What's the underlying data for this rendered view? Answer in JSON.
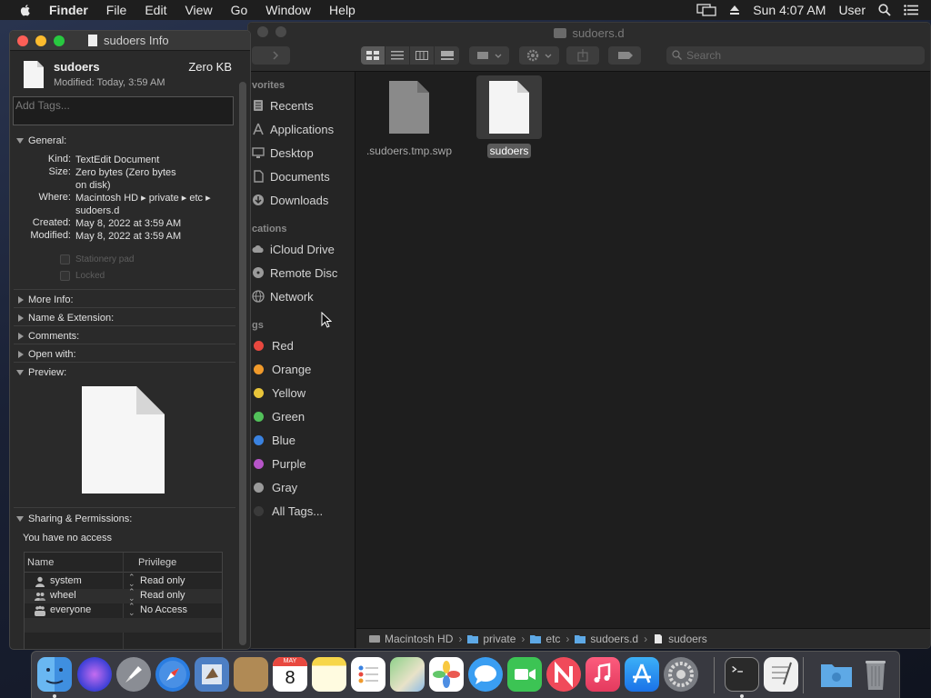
{
  "menubar": {
    "app": "Finder",
    "items": [
      "File",
      "Edit",
      "View",
      "Go",
      "Window",
      "Help"
    ],
    "clock": "Sun 4:07 AM",
    "user": "User",
    "status_icons": [
      "display-mirroring-icon",
      "eject-icon",
      "spotlight-icon",
      "notification-center-icon"
    ]
  },
  "finder": {
    "title": "sudoers.d",
    "search_placeholder": "Search",
    "sidebar": {
      "favorites_header": "vorites",
      "favorites": [
        "Recents",
        "Applications",
        "Desktop",
        "Documents",
        "Downloads"
      ],
      "locations_header": "cations",
      "locations": [
        "iCloud Drive",
        "Remote Disc",
        "Network"
      ],
      "tags_header": "gs",
      "tags": [
        {
          "name": "Red",
          "color": "#e8483f"
        },
        {
          "name": "Orange",
          "color": "#f09a2b"
        },
        {
          "name": "Yellow",
          "color": "#e9c53a"
        },
        {
          "name": "Green",
          "color": "#52c15a"
        },
        {
          "name": "Blue",
          "color": "#3a82e0"
        },
        {
          "name": "Purple",
          "color": "#b655c8"
        },
        {
          "name": "Gray",
          "color": "#9a9a9a"
        }
      ],
      "all_tags": "All Tags..."
    },
    "files": [
      {
        "name": ".sudoers.tmp.swp",
        "selected": false
      },
      {
        "name": "sudoers",
        "selected": true
      }
    ],
    "path": [
      "Macintosh HD",
      "private",
      "etc",
      "sudoers.d",
      "sudoers"
    ]
  },
  "info": {
    "window_title": "sudoers Info",
    "file_name": "sudoers",
    "file_size": "Zero KB",
    "modified_short": "Modified: Today, 3:59 AM",
    "tags_placeholder": "Add Tags...",
    "general_header": "General:",
    "general": {
      "kind_label": "Kind:",
      "kind": "TextEdit Document",
      "size_label": "Size:",
      "size_line1": "Zero bytes (Zero bytes",
      "size_line2": "on disk)",
      "where_label": "Where:",
      "where_line1": "Macintosh HD ▸ private ▸ etc ▸",
      "where_line2": "sudoers.d",
      "created_label": "Created:",
      "created": "May 8, 2022 at 3:59 AM",
      "modified_label": "Modified:",
      "modified": "May 8, 2022 at 3:59 AM"
    },
    "stationery_pad": "Stationery pad",
    "locked": "Locked",
    "sections": [
      "More Info:",
      "Name & Extension:",
      "Comments:",
      "Open with:"
    ],
    "preview_header": "Preview:",
    "sharing_header": "Sharing & Permissions:",
    "access_message": "You have no access",
    "perm_columns": {
      "name": "Name",
      "privilege": "Privilege"
    },
    "permissions": [
      {
        "name": "system",
        "privilege": "Read only"
      },
      {
        "name": "wheel",
        "privilege": "Read only"
      },
      {
        "name": "everyone",
        "privilege": "No Access"
      }
    ]
  },
  "dock": {
    "apps": [
      "Finder",
      "Siri",
      "Launchpad",
      "Safari",
      "Mail",
      "Contacts",
      "Calendar",
      "Notes",
      "Reminders",
      "Maps",
      "Photos",
      "Messages",
      "FaceTime",
      "News",
      "Music",
      "App Store",
      "System Preferences",
      "Terminal",
      "TextEdit",
      "Downloads",
      "Trash"
    ],
    "calendar_month": "MAY",
    "calendar_day": "8"
  }
}
